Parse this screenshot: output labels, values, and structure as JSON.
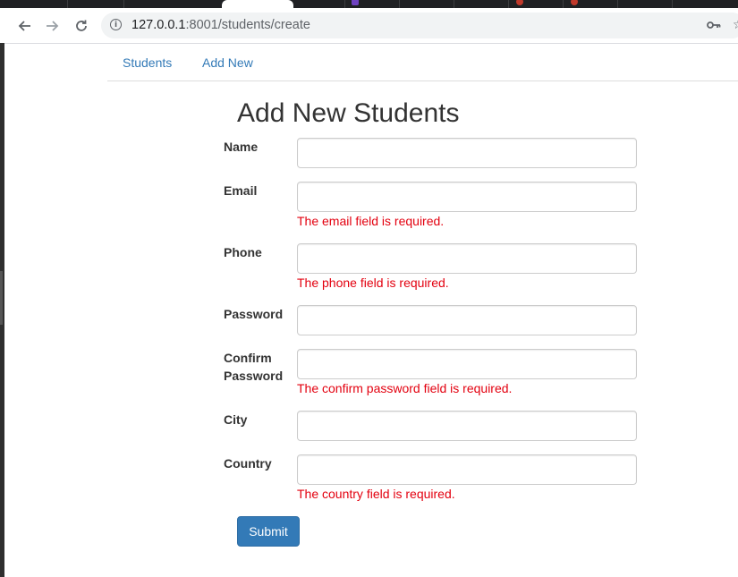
{
  "browser": {
    "url_host": "127.0.0.1",
    "url_rest": ":8001/students/create"
  },
  "navbar": {
    "links": [
      "Students",
      "Add New"
    ]
  },
  "form": {
    "title": "Add New Students",
    "fields": [
      {
        "label": "Name",
        "value": "",
        "error": ""
      },
      {
        "label": "Email",
        "value": "",
        "error": "The email field is required."
      },
      {
        "label": "Phone",
        "value": "",
        "error": "The phone field is required."
      },
      {
        "label": "Password",
        "value": "",
        "error": ""
      },
      {
        "label_line1": "Confirm",
        "label_line2": "Password",
        "value": "",
        "error": "The confirm password field is required."
      },
      {
        "label": "City",
        "value": "",
        "error": ""
      },
      {
        "label": "Country",
        "value": "",
        "error": "The country field is required."
      }
    ],
    "submit_label": "Submit"
  },
  "colors": {
    "link": "#337ab7",
    "error": "#e3000f",
    "primary_button": "#337ab7"
  }
}
